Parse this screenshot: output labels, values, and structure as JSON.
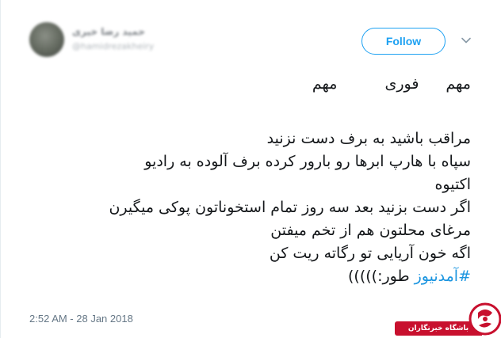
{
  "author": {
    "display_name": "حمید رضا خیری",
    "handle": "@hamidrezakheiry"
  },
  "follow_label": "Follow",
  "tweet": {
    "urgent_words": [
      "مهم",
      "فوری",
      "مهم"
    ],
    "lines": [
      "مراقب باشید به برف دست نزنید",
      "سپاه با هارپ ابرها رو بارور کرده برف آلوده به رادیو",
      "اکتیوه",
      "اگر دست بزنید بعد سه روز تمام استخوناتون پوکی میگیرن",
      "مرغای محلتون هم از تخم میفتن",
      "اگه خون آریایی تو رگاته ریت کن"
    ],
    "hashtag": "#آمدنیوز",
    "after_hashtag": " طور:)))))"
  },
  "timestamp": "2:52 AM - 28 Jan 2018",
  "watermark": {
    "text": "باشگاه خبرنگاران",
    "logo_icon": "yjc-logo-icon"
  },
  "colors": {
    "accent": "#1da1f2",
    "hashtag": "#1b95e0",
    "text": "#14171a",
    "muted": "#657786",
    "watermark_red": "#c8102e"
  }
}
